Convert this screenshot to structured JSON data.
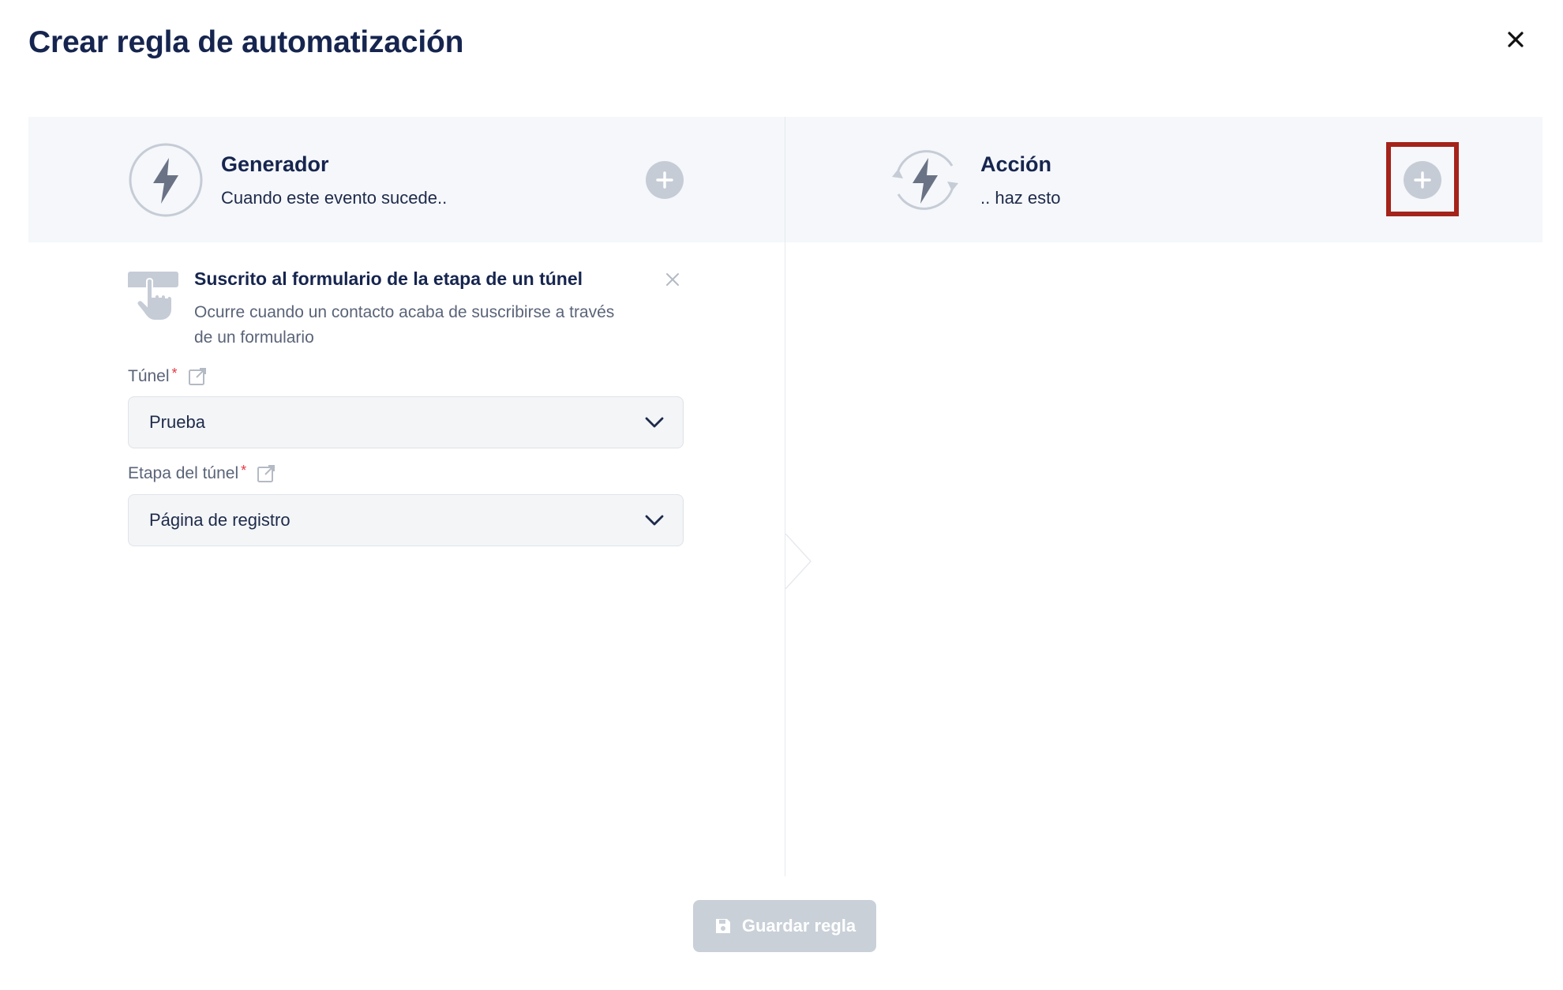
{
  "modal": {
    "title": "Crear regla de automatización",
    "close_icon": "close-icon"
  },
  "trigger_section": {
    "heading": "Generador",
    "subheading": "Cuando este evento sucede..",
    "icon": "bolt-icon",
    "add_icon": "plus-icon"
  },
  "action_section": {
    "heading": "Acción",
    "subheading": ".. haz esto",
    "icon": "bolt-cycle-icon",
    "add_icon": "plus-icon"
  },
  "selected_trigger": {
    "title": "Suscrito al formulario de la etapa de un túnel",
    "description": "Ocurre cuando un contacto acaba de suscribirse a través de un formulario",
    "icon": "hand-pointer-icon"
  },
  "fields": {
    "funnel": {
      "label": "Túnel",
      "required_mark": "*",
      "value": "Prueba"
    },
    "funnel_step": {
      "label": "Etapa del túnel",
      "required_mark": "*",
      "value": "Página de registro"
    }
  },
  "footer": {
    "save_label": "Guardar regla",
    "save_icon": "floppy-disk-icon"
  },
  "colors": {
    "title": "#16254f",
    "highlight": "#a4231a",
    "disabled_button": "#c9d0d8",
    "required": "#e53945"
  }
}
